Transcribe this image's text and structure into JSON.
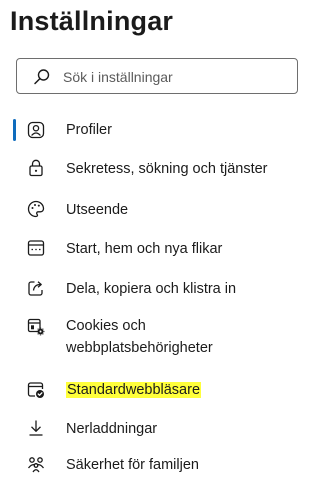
{
  "page": {
    "title": "Inställningar"
  },
  "search": {
    "placeholder": "Sök i inställningar"
  },
  "sidebar": {
    "items": [
      {
        "label": "Profiler",
        "icon": "profile-icon",
        "selected": true
      },
      {
        "label": "Sekretess, sökning och tjänster",
        "icon": "lock-icon"
      },
      {
        "label": "Utseende",
        "icon": "palette-icon"
      },
      {
        "label": "Start, hem och nya flikar",
        "icon": "home-page-icon"
      },
      {
        "label": "Dela, kopiera och klistra in",
        "icon": "share-icon"
      },
      {
        "label": "Cookies och webbplatsbehörigheter",
        "icon": "cookie-settings-icon"
      },
      {
        "label": "Standardwebbläsare",
        "icon": "default-browser-icon",
        "highlighted": true
      },
      {
        "label": "Nerladdningar",
        "icon": "download-icon"
      },
      {
        "label": "Säkerhet för familjen",
        "icon": "family-icon"
      }
    ]
  },
  "colors": {
    "accent": "#0f6cbd",
    "highlight": "#ffff3b",
    "text": "#1b1b1b"
  }
}
